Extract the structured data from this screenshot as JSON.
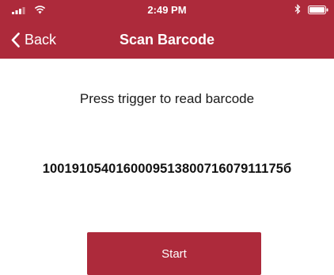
{
  "status_bar": {
    "time": "2:49 PM"
  },
  "nav": {
    "back_label": "Back",
    "title": "Scan Barcode"
  },
  "content": {
    "instruction": "Press trigger to read barcode",
    "barcode_value": "100191054016000951380071607911175б"
  },
  "actions": {
    "start_label": "Start"
  },
  "colors": {
    "brand": "#ad2a3b",
    "background": "#ffffff",
    "text": "#1a1a1a"
  },
  "icons": [
    "signal-icon",
    "wifi-icon",
    "bluetooth-icon",
    "battery-icon",
    "back-chevron-icon"
  ]
}
